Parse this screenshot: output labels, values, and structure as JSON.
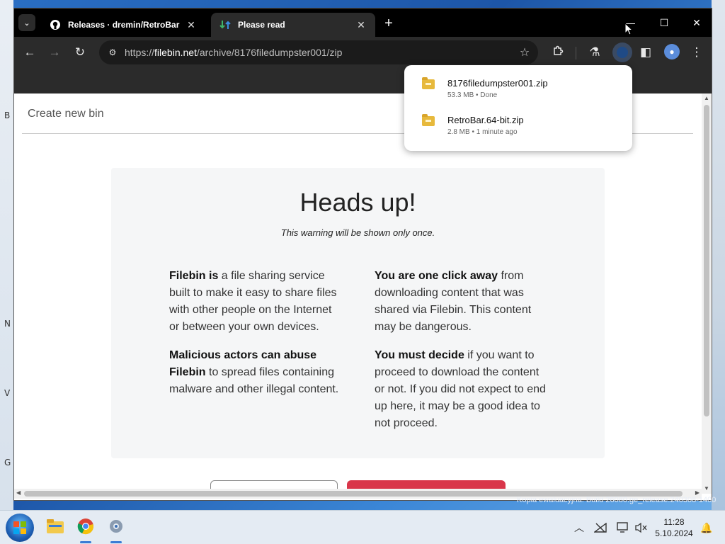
{
  "desktop": {
    "left_edge_letters": [
      "B",
      "N",
      "V",
      "G"
    ]
  },
  "browser": {
    "tabs": [
      {
        "title": "Releases · dremin/RetroBar",
        "icon": "github-icon",
        "active": false
      },
      {
        "title": "Please read",
        "icon": "filebin-icon",
        "active": true
      }
    ],
    "new_tab_label": "+",
    "url": {
      "scheme": "https://",
      "host": "filebin.net",
      "path": "/archive/8176filedumpster001/zip"
    }
  },
  "downloads": [
    {
      "name": "8176filedumpster001.zip",
      "meta": "53.3 MB • Done"
    },
    {
      "name": "RetroBar.64-bit.zip",
      "meta": "2.8 MB • 1 minute ago"
    }
  ],
  "page": {
    "nav_link": "Create new bin",
    "heading": "Heads up!",
    "subtitle": "This warning will be shown only once.",
    "left_paragraphs": [
      {
        "bold": "Filebin is",
        "text": " a file sharing service built to make it easy to share files with other people on the Internet or between your own devices."
      },
      {
        "bold": "Malicious actors can abuse Filebin",
        "text": " to spread files containing malware and other illegal content."
      }
    ],
    "right_paragraphs": [
      {
        "bold": "You are one click away",
        "text": " from downloading content that was shared via Filebin. This content may be dangerous."
      },
      {
        "bold": "You must decide",
        "text": " if you want to proceed to download the content or not. If you did not expect to end up here, it may be a good idea to not proceed."
      }
    ]
  },
  "watermark": "Kopia ewaluacyjna. Build 26080.ge_release.240308-1400",
  "taskbar": {
    "apps": [
      "file-explorer-icon",
      "chrome-icon",
      "retrobar-settings-icon"
    ],
    "time": "11:28",
    "date": "5.10.2024"
  },
  "colors": {
    "danger_button": "#d9364a",
    "card_bg": "#f5f6f7",
    "chrome_dark": "#2b2b2b"
  }
}
